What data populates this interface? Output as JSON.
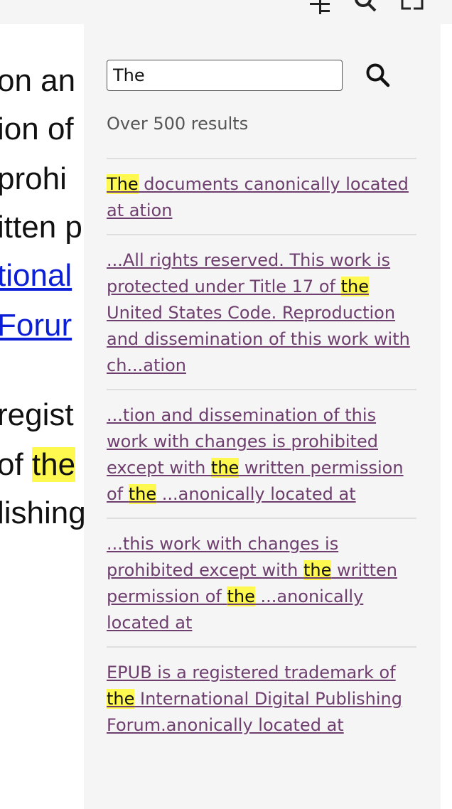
{
  "book_text": {
    "lines": [
      {
        "text": "on an",
        "link": false
      },
      {
        "text": "ion of",
        "link": false
      },
      {
        "text": " prohi",
        "link": false
      },
      {
        "text": "itten p",
        "link": false
      },
      {
        "text": "tional",
        "link": true
      },
      {
        "text": " Forur",
        "link": true
      }
    ],
    "line2": [
      {
        "segments": [
          {
            "text": "regist",
            "highlight": false
          }
        ]
      },
      {
        "segments": [
          {
            "text": "of ",
            "highlight": false
          },
          {
            "text": "the",
            "highlight": true
          }
        ]
      },
      {
        "segments": [
          {
            "text": "lishing",
            "highlight": false
          }
        ]
      }
    ]
  },
  "toolbar": {
    "icons": [
      "toc-icon",
      "search-icon",
      "fullscreen-icon"
    ]
  },
  "search": {
    "value": "The",
    "button_icon": "search-icon",
    "count": "Over 500 results"
  },
  "results": [
    {
      "segments": [
        {
          "text": "The",
          "highlight": true
        },
        {
          "text": " documents canonically located at ation",
          "highlight": false
        }
      ]
    },
    {
      "segments": [
        {
          "text": "...All rights reserved. This work is protected under Title 17 of ",
          "highlight": false
        },
        {
          "text": "the",
          "highlight": true
        },
        {
          "text": " United States Code. Reproduction and dissemination of this work with ch...ation",
          "highlight": false
        }
      ]
    },
    {
      "segments": [
        {
          "text": "...tion and dissemination of this work with changes is prohibited except with ",
          "highlight": false
        },
        {
          "text": "the",
          "highlight": true
        },
        {
          "text": " written permission of ",
          "highlight": false
        },
        {
          "text": "the",
          "highlight": true
        },
        {
          "text": " ...anonically located at",
          "highlight": false
        }
      ]
    },
    {
      "segments": [
        {
          "text": "...this work with changes is prohibited except with ",
          "highlight": false
        },
        {
          "text": "the",
          "highlight": true
        },
        {
          "text": " written permission of ",
          "highlight": false
        },
        {
          "text": "the",
          "highlight": true
        },
        {
          "text": " ...anonically located at",
          "highlight": false
        }
      ]
    },
    {
      "segments": [
        {
          "text": "EPUB is a registered trademark of ",
          "highlight": false
        },
        {
          "text": "the",
          "highlight": true
        },
        {
          "text": " International Digital Publishing Forum.anonically located at",
          "highlight": false
        }
      ]
    }
  ],
  "colors": {
    "highlight": "#fff94f",
    "result_link": "#6e3f6e",
    "book_link": "#0b1fd6",
    "panel_bg": "#f5f5f5"
  }
}
